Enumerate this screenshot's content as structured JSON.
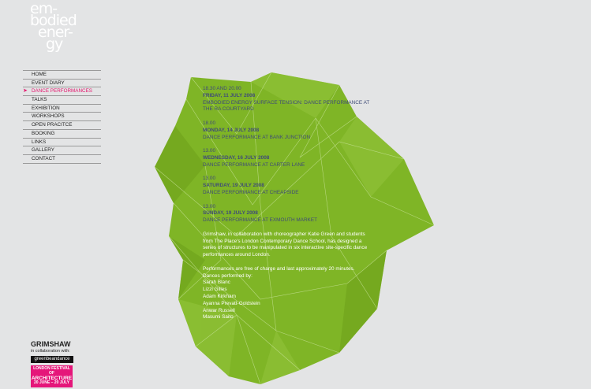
{
  "logo": {
    "line1": "em-",
    "line2": "bodied",
    "line3": "ener-",
    "line4": "gy"
  },
  "nav": {
    "items": [
      {
        "label": "HOME"
      },
      {
        "label": "EVENT DIARY"
      },
      {
        "label": "DANCE PERFORMANCES",
        "active": true
      },
      {
        "label": "TALKS"
      },
      {
        "label": "EXHIBITION"
      },
      {
        "label": "WORKSHOPS"
      },
      {
        "label": "OPEN PRACITCE"
      },
      {
        "label": "BOOKING"
      },
      {
        "label": "LINKS"
      },
      {
        "label": "GALLERY"
      },
      {
        "label": "CONTACT"
      }
    ]
  },
  "colors": {
    "background": "#e3e4e5",
    "shape_green": "#7fb526",
    "accent_pink": "#e4136c",
    "event_text": "#3f4b78"
  },
  "performances": [
    {
      "time": "18.30 AND 20.00",
      "date": "FRIDAY, 11 JULY 2008",
      "title": "EMBODIED ENERGY SURFACE TENSION: DANCE PERFORMANCE AT THE RA COURTYARD"
    },
    {
      "time": "18.00",
      "date": "MONDAY, 14 JULY 2008",
      "title": "DANCE PERFORMANCE AT BANK JUNCTION"
    },
    {
      "time": "13.00",
      "date": "WEDNESDAY, 16 JULY 2008",
      "title": "DANCE PERFORMANCE AT CARTER LANE"
    },
    {
      "time": "13.00",
      "date": "SATURDAY, 19 JULY 2008",
      "title": "DANCE PERFORMANCE AT CHEAPSIDE"
    },
    {
      "time": "13.00",
      "date": "SUNDAY, 19 JULY 2008",
      "title": "DANCE PERFORMANCE AT EXMOUTH MARKET"
    }
  ],
  "description": {
    "para1": "Grimshaw, in collaboration with choreographer Katie Green and students from The Place's London Contemporary Dance School, has designed a series of structures to be manipulated in six interactive site-specific dance performances around London.",
    "para2": "Performances are free of charge and last approximately 20 minutes.",
    "dancers_intro": "Dances performed by:",
    "dancers": [
      "Sarah Blanc",
      "Lizzi Gilles",
      "Adam Kirkham",
      "Ayanna Prevatt-Goldstein",
      "Anwar Russell",
      "Masumi Saito"
    ]
  },
  "credits": {
    "company": "GRIMSHAW",
    "collab": "in collaboration with:",
    "partner": "greenbeandance",
    "festival_line1": "LONDON FESTIVAL OF",
    "festival_line2": "ARCHITECTURE",
    "festival_dates": "20 JUNE – 20 JULY"
  }
}
